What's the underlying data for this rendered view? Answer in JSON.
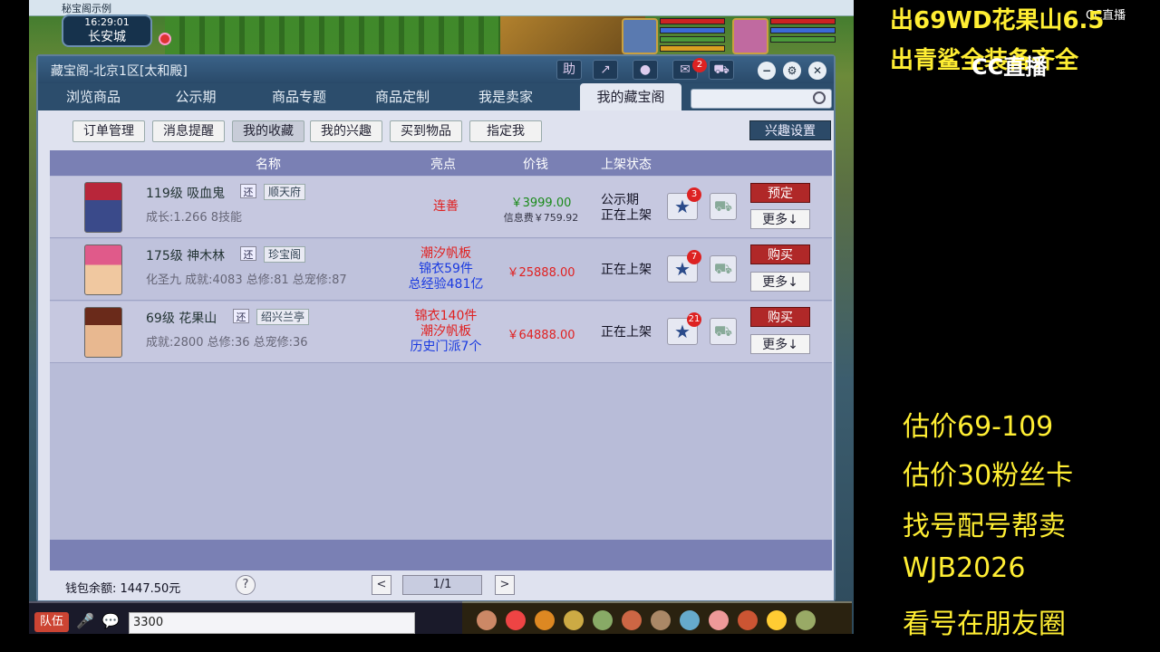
{
  "game": {
    "window_title": "秘宝阁示例",
    "time": "16:29:01",
    "location": "长安城"
  },
  "window": {
    "title": "藏宝阁-北京1区[太和殿]",
    "help_label": "助",
    "msg_count": "2"
  },
  "tabs": [
    "浏览商品",
    "公示期",
    "商品专题",
    "商品定制",
    "我是卖家",
    "我的藏宝阁"
  ],
  "subtabs": [
    "订单管理",
    "消息提醒",
    "我的收藏",
    "我的兴趣",
    "买到物品",
    "指定我"
  ],
  "interest_settings": "兴趣设置",
  "columns": {
    "name": "名称",
    "highlight": "亮点",
    "price": "价钱",
    "status": "上架状态"
  },
  "rows": [
    {
      "level_name": "119级 吸血鬼",
      "huan": "还",
      "server": "顺天府",
      "stats": "成长:1.266 8技能",
      "highlights": [
        {
          "text": "连善",
          "color": "red"
        }
      ],
      "price": "￥3999.00",
      "price_note": "信息费￥759.92",
      "status": [
        "公示期",
        "正在上架"
      ],
      "fav_count": "3",
      "action": "预定",
      "more": "更多↓"
    },
    {
      "level_name": "175级 神木林",
      "huan": "还",
      "server": "珍宝阁",
      "stats": "化圣九 成就:4083 总修:81 总宠修:87",
      "highlights": [
        {
          "text": "潮汐帆板",
          "color": "red"
        },
        {
          "text": "锦衣59件",
          "color": "blue"
        },
        {
          "text": "总经验481亿",
          "color": "blue"
        }
      ],
      "price": "￥25888.00",
      "price_note": "",
      "status": [
        "正在上架"
      ],
      "fav_count": "7",
      "action": "购买",
      "more": "更多↓"
    },
    {
      "level_name": "69级 花果山",
      "huan": "还",
      "server": "绍兴兰亭",
      "stats": "成就:2800 总修:36 总宠修:36",
      "highlights": [
        {
          "text": "锦衣140件",
          "color": "red"
        },
        {
          "text": "潮汐帆板",
          "color": "red"
        },
        {
          "text": "历史门派7个",
          "color": "blue"
        }
      ],
      "price": "￥64888.00",
      "price_note": "",
      "status": [
        "正在上架"
      ],
      "fav_count": "21",
      "action": "购买",
      "more": "更多↓"
    }
  ],
  "footer": {
    "wallet": "钱包余额: 1447.50元",
    "help": "?",
    "page": "1/1",
    "prev": "<",
    "next": ">"
  },
  "chat": {
    "team": "队伍",
    "input_value": "3300"
  },
  "overlay": {
    "title_lines": [
      "出69WD花果山6.5",
      "出青鲨全装备齐全"
    ],
    "lines": [
      "估价69-109",
      "估价30粉丝卡",
      "找号配号帮卖",
      " WJB2026",
      "看号在朋友圈"
    ],
    "logo": "CC直播"
  },
  "colors": {
    "red": "#e02020",
    "blue": "#1a3ae0",
    "overlay": "#ffee33",
    "accent": "#2c4d6c"
  }
}
